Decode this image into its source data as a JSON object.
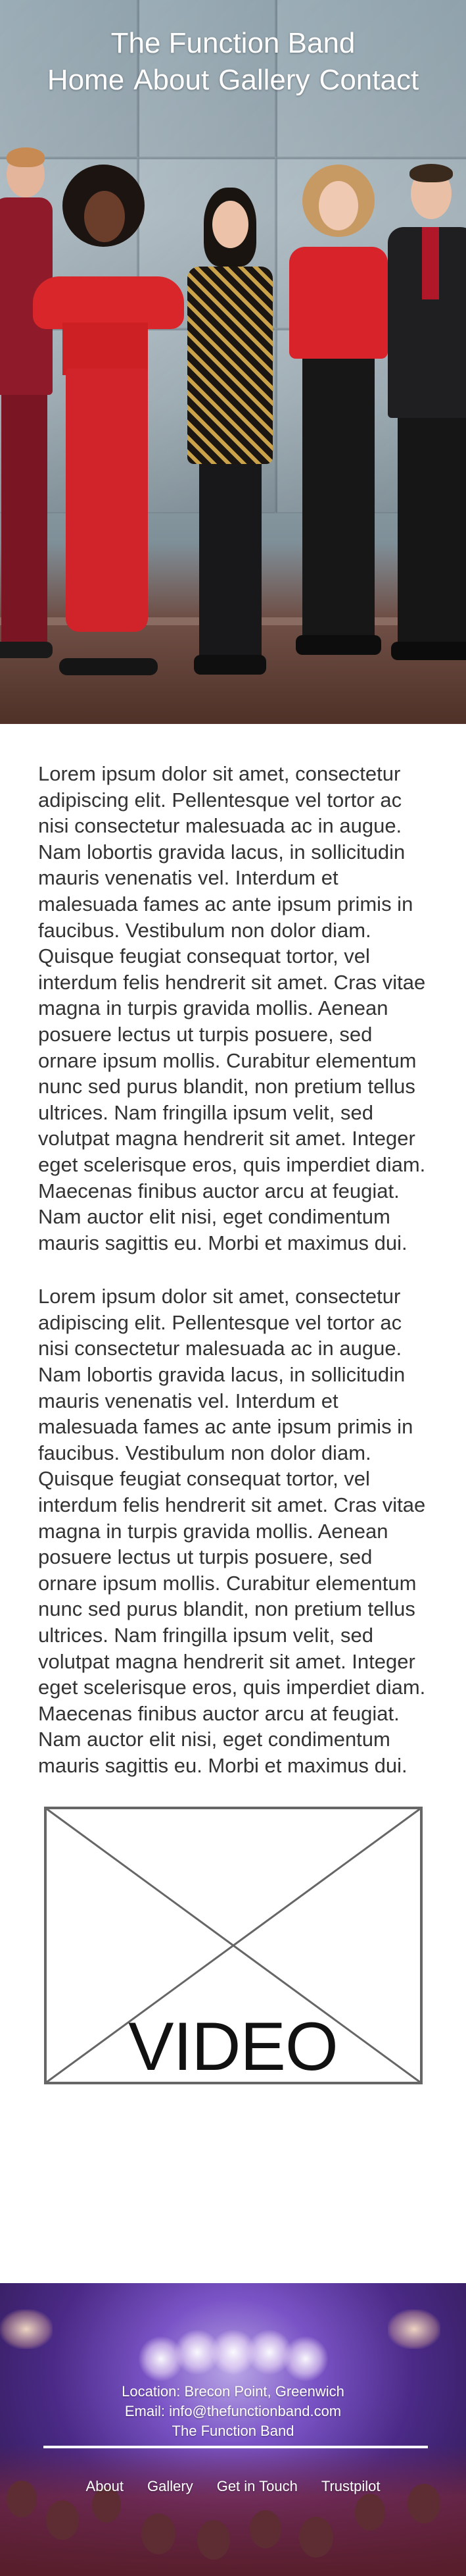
{
  "header": {
    "site_title": "The Function Band",
    "nav": [
      "Home",
      "About",
      "Gallery",
      "Contact"
    ]
  },
  "hero": {
    "image_description_icon": "band-photo"
  },
  "content": {
    "paragraphs": [
      "Lorem ipsum dolor sit amet, consectetur adipiscing elit. Pellentesque vel tortor ac nisi consectetur malesuada ac in augue. Nam lobortis gravida lacus, in sollicitudin mauris venenatis vel. Interdum et malesuada fames ac ante ipsum primis in faucibus. Vestibulum non dolor diam. Quisque feugiat consequat tortor, vel interdum felis hendrerit sit amet. Cras vitae magna in turpis gravida mollis. Aenean posuere lectus ut turpis posuere, sed ornare ipsum mollis. Curabitur elementum nunc sed purus blandit, non pretium tellus ultrices. Nam fringilla ipsum velit, sed volutpat magna hendrerit sit amet. Integer eget scelerisque eros, quis imperdiet diam. Maecenas finibus auctor arcu at feugiat. Nam auctor elit nisi, eget condimentum mauris sagittis eu. Morbi et maximus dui.",
      "Lorem ipsum dolor sit amet, consectetur adipiscing elit. Pellentesque vel tortor ac nisi consectetur malesuada ac in augue. Nam lobortis gravida lacus, in sollicitudin mauris venenatis vel. Interdum et malesuada fames ac ante ipsum primis in faucibus. Vestibulum non dolor diam. Quisque feugiat consequat tortor, vel interdum felis hendrerit sit amet. Cras vitae magna in turpis gravida mollis. Aenean posuere lectus ut turpis posuere, sed ornare ipsum mollis. Curabitur elementum nunc sed purus blandit, non pretium tellus ultrices. Nam fringilla ipsum velit, sed volutpat magna hendrerit sit amet. Integer eget scelerisque eros, quis imperdiet diam. Maecenas finibus auctor arcu at feugiat. Nam auctor elit nisi, eget condimentum mauris sagittis eu. Morbi et maximus dui."
    ]
  },
  "video": {
    "label": "VIDEO"
  },
  "footer": {
    "location": "Location: Brecon Point, Greenwich",
    "email": "Email: info@thefunctionband.com",
    "brand": "The Function Band",
    "links": [
      "About",
      "Gallery",
      "Get in Touch",
      "Trustpilot"
    ]
  },
  "colors": {
    "text": "#333333",
    "nav_text": "#ffffff",
    "footer_purple": "#7a54c6"
  }
}
